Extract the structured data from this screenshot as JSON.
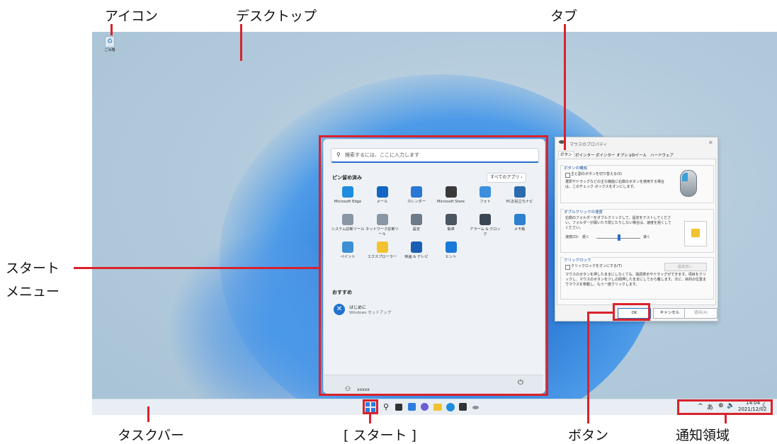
{
  "annotations": {
    "icon": "アイコン",
    "desktop": "デスクトップ",
    "tab": "タブ",
    "start_menu_1": "スタート",
    "start_menu_2": "メニュー",
    "taskbar": "タスクバー",
    "start": "[ スタート ]",
    "button": "ボタン",
    "notification": "通知領域"
  },
  "desktop": {
    "recycle_bin_label": "ごみ箱"
  },
  "start_menu": {
    "search_placeholder": "検索するには、ここに入力します",
    "pinned_title": "ピン留め済み",
    "all_apps": "すべてのアプリ  ›",
    "apps": [
      {
        "label": "Microsoft Edge",
        "color": "#1f8ce0"
      },
      {
        "label": "メール",
        "color": "#1466c4"
      },
      {
        "label": "カレンダー",
        "color": "#2a78d4"
      },
      {
        "label": "Microsoft Store",
        "color": "#3a3a3a"
      },
      {
        "label": "フォト",
        "color": "#3c8fde"
      },
      {
        "label": "PCお役立ちナビ",
        "color": "#2a6bb0"
      },
      {
        "label": "システム診断ツール",
        "color": "#8a96a3"
      },
      {
        "label": "ネットワーク診断ツール",
        "color": "#8a96a3"
      },
      {
        "label": "設定",
        "color": "#6d7a88"
      },
      {
        "label": "電卓",
        "color": "#4a5560"
      },
      {
        "label": "アラーム & クロック",
        "color": "#3a4652"
      },
      {
        "label": "メモ帳",
        "color": "#2f7fd0"
      },
      {
        "label": "ペイント",
        "color": "#3d8fd6"
      },
      {
        "label": "エクスプローラー",
        "color": "#f2c230"
      },
      {
        "label": "映画 & テレビ",
        "color": "#1b5fb5"
      },
      {
        "label": "ヒント",
        "color": "#1a79d8"
      }
    ],
    "recommended_title": "おすすめ",
    "recommended": {
      "title": "はじめに",
      "subtitle": "Windows セットアップ"
    },
    "user": "xxxxx",
    "power_icon": "power-icon"
  },
  "dialog": {
    "title": "マウスのプロパティ",
    "tabs": [
      "ボタン",
      "ポインター",
      "ポインター オプション",
      "ホイール",
      "ハードウェア"
    ],
    "group1_title": "ボタンの構成",
    "group1_checkbox": "主と副のボタンを切り替える(S)",
    "group1_text": "選択やドラッグなどの主な機能に右側のボタンを使用する場合は、このチェック ボックスをオンにします。",
    "group2_title": "ダブルクリックの速度",
    "group2_text": "右側のフォルダーをダブルクリックして、設定をテストしてください。フォルダーが開いたり閉じたりしない場合は、速度を遅くしてください。",
    "speed_label": "速度(D):",
    "slow": "遅く",
    "fast": "速く",
    "group3_title": "クリックロック",
    "group3_checkbox": "クリックロックをオンにする(T)",
    "settings_btn": "設定(E)...",
    "group3_text": "マウスのボタンを押したままにしなくても、強調表示やドラッグができます。項目をクリックし、マウスのボタンを少しの間押したままにしてから離します。次に、目的の位置までマウスを移動し、もう一度クリックします。",
    "ok": "OK",
    "cancel": "キャンセル",
    "apply": "適用(A)"
  },
  "tray": {
    "chevron": "^",
    "ime": "あ",
    "time": "14:04",
    "date": "2021/12/02"
  }
}
